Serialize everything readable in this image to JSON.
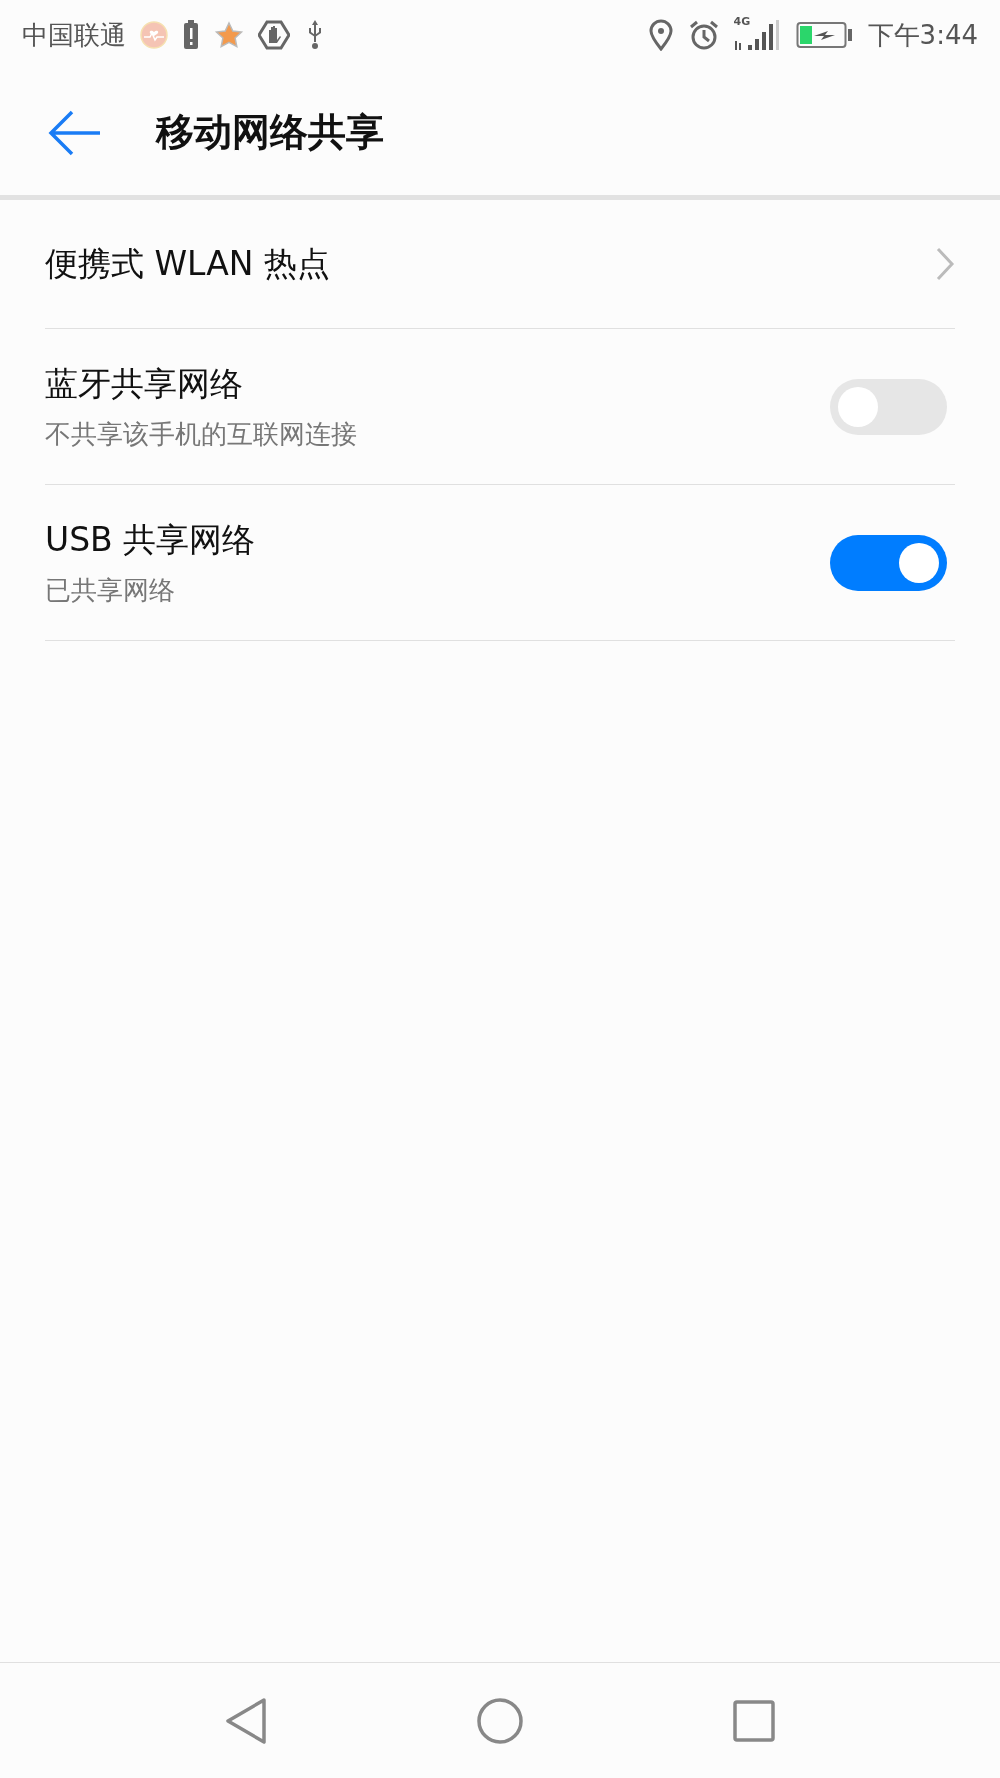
{
  "status_bar": {
    "carrier": "中国联通",
    "network": "4G",
    "time": "下午3:44"
  },
  "header": {
    "title": "移动网络共享"
  },
  "items": [
    {
      "kind": "link",
      "title": "便携式 WLAN 热点"
    },
    {
      "kind": "toggle",
      "title": "蓝牙共享网络",
      "subtitle": "不共享该手机的互联网连接",
      "on": false
    },
    {
      "kind": "toggle",
      "title": "USB 共享网络",
      "subtitle": "已共享网络",
      "on": true
    }
  ]
}
